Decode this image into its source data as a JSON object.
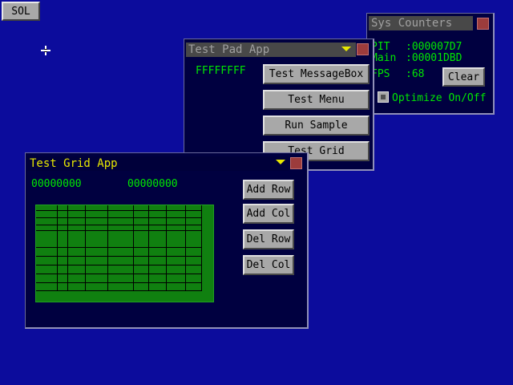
{
  "taskbar": {
    "start_label": "SOL"
  },
  "sys_counters": {
    "title": "Sys Counters",
    "pit_label": "PIT",
    "pit_value": ":000007D7",
    "main_label": "Main",
    "main_value": ":00001DBD",
    "fps_label": "FPS",
    "fps_value": ":68",
    "clear_label": "Clear",
    "optimize_label": "Optimize On/Off"
  },
  "test_pad": {
    "title": "Test Pad App",
    "hex_value": "FFFFFFFF",
    "buttons": [
      "Test MessageBox",
      "Test Menu",
      "Run Sample",
      "Test Grid"
    ]
  },
  "test_grid": {
    "title": "Test Grid App",
    "value_left": "00000000",
    "value_right": "00000000",
    "buttons": [
      "Add Row",
      "Add Col",
      "Del Row",
      "Del Col"
    ]
  },
  "colors": {
    "desktop": "#0c0c9c",
    "window_bg": "#000040",
    "text_green": "#00e800",
    "title_active": "#e8e800",
    "close_red": "#9c3c3c"
  }
}
